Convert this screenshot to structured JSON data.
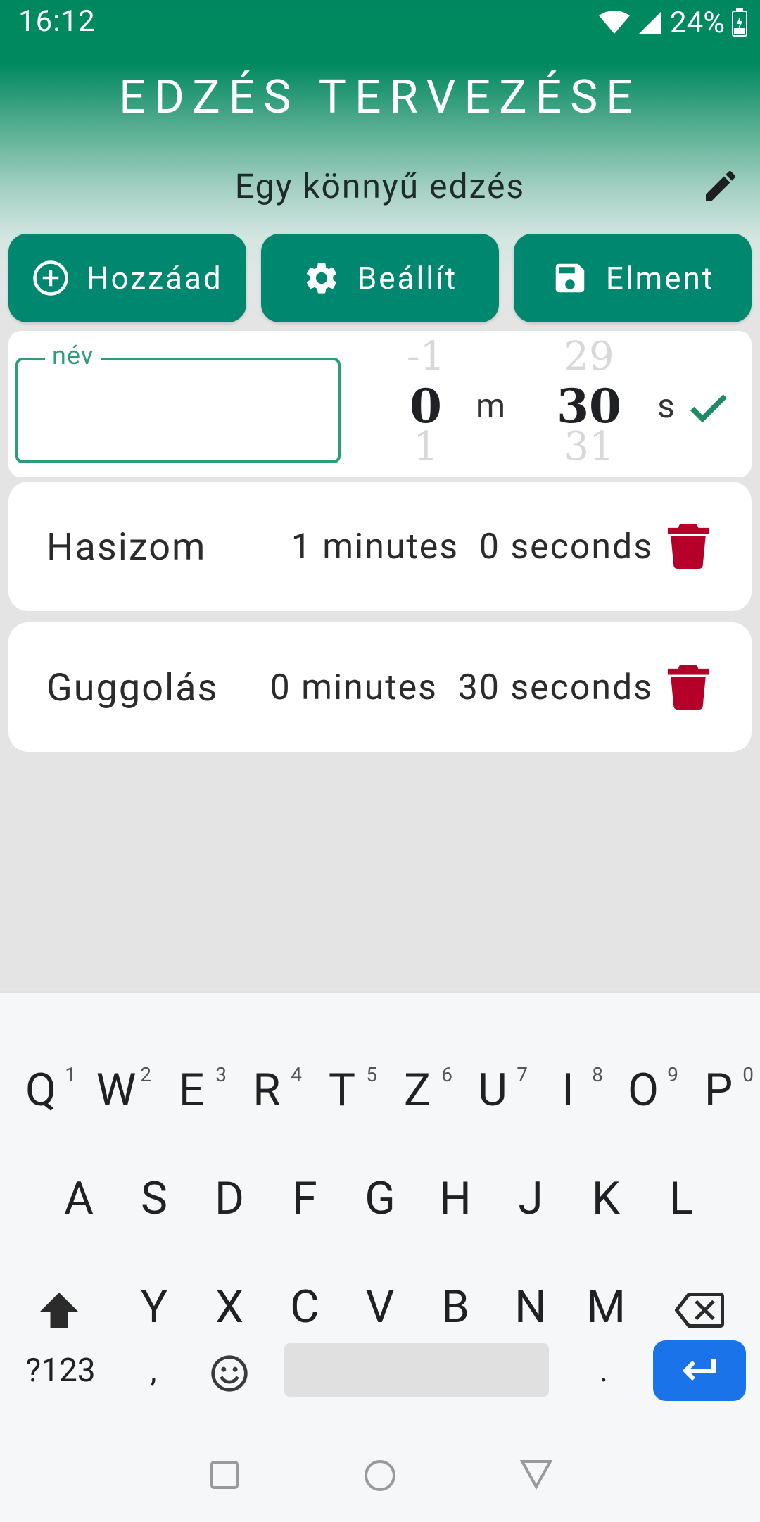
{
  "status_bar": {
    "time": "16:12",
    "battery": "24%"
  },
  "app_title": "EDZÉS TERVEZÉSE",
  "workout_name": "Egy könnyű edzés",
  "buttons": {
    "add": "Hozzáad",
    "settings": "Beállít",
    "save": "Elment"
  },
  "entry": {
    "name_label": "név",
    "name_value": "",
    "minutes": {
      "prev": "-1",
      "current": "0",
      "next": "1",
      "unit": "m"
    },
    "seconds": {
      "prev": "29",
      "current": "30",
      "next": "31",
      "unit": "s"
    }
  },
  "exercises": [
    {
      "name": "Hasizom",
      "duration": "1 minutes  0 seconds"
    },
    {
      "name": "Guggolás",
      "duration": "0 minutes  30 seconds"
    }
  ],
  "keyboard": {
    "row1": [
      {
        "k": "Q",
        "h": "1"
      },
      {
        "k": "W",
        "h": "2"
      },
      {
        "k": "E",
        "h": "3"
      },
      {
        "k": "R",
        "h": "4"
      },
      {
        "k": "T",
        "h": "5"
      },
      {
        "k": "Z",
        "h": "6"
      },
      {
        "k": "U",
        "h": "7"
      },
      {
        "k": "I",
        "h": "8"
      },
      {
        "k": "O",
        "h": "9"
      },
      {
        "k": "P",
        "h": "0"
      }
    ],
    "row2": [
      "A",
      "S",
      "D",
      "F",
      "G",
      "H",
      "J",
      "K",
      "L"
    ],
    "row3": [
      "Y",
      "X",
      "C",
      "V",
      "B",
      "N",
      "M"
    ],
    "symbols": "?123",
    "comma": ",",
    "period": "."
  },
  "colors": {
    "accent": "#00876f",
    "delete": "#b5002a",
    "enter": "#1a73e8"
  },
  "icons": [
    "wifi-icon",
    "signal-icon",
    "battery-icon",
    "edit-icon",
    "add-circle-icon",
    "gear-icon",
    "save-icon",
    "check-icon",
    "trash-icon",
    "shift-icon",
    "backspace-icon",
    "emoji-icon",
    "enter-icon"
  ]
}
